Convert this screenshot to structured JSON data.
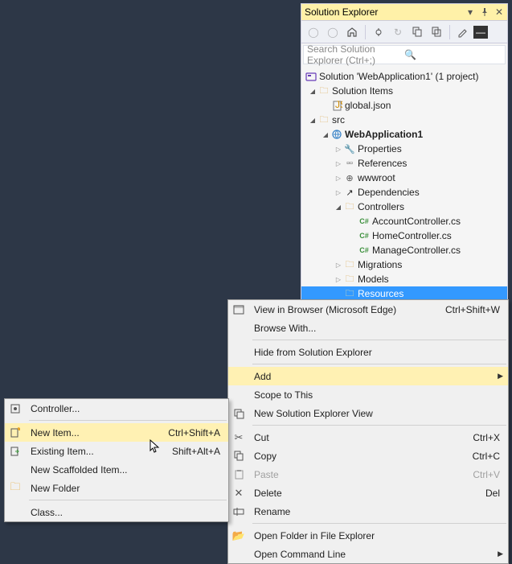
{
  "panel": {
    "title": "Solution Explorer",
    "search_placeholder": "Search Solution Explorer (Ctrl+;)",
    "solution_line": "Solution 'WebApplication1' (1 project)"
  },
  "tree": {
    "solutionItems": "Solution Items",
    "globalJson": "global.json",
    "src": "src",
    "project": "WebApplication1",
    "properties": "Properties",
    "references": "References",
    "wwwroot": "wwwroot",
    "dependencies": "Dependencies",
    "controllers": "Controllers",
    "ctrl1": "AccountController.cs",
    "ctrl2": "HomeController.cs",
    "ctrl3": "ManageController.cs",
    "migrations": "Migrations",
    "models": "Models",
    "resources": "Resources"
  },
  "menu1": [
    {
      "icon": "browser",
      "label": "View in Browser (Microsoft Edge)",
      "shortcut": "Ctrl+Shift+W"
    },
    {
      "icon": "",
      "label": "Browse With..."
    },
    {
      "sep": true
    },
    {
      "icon": "",
      "label": "Hide from Solution Explorer"
    },
    {
      "sep": true
    },
    {
      "icon": "",
      "label": "Add",
      "sub": true,
      "hl": true
    },
    {
      "icon": "",
      "label": "Scope to This"
    },
    {
      "icon": "newview",
      "label": "New Solution Explorer View"
    },
    {
      "sep": true
    },
    {
      "icon": "cut",
      "label": "Cut",
      "shortcut": "Ctrl+X"
    },
    {
      "icon": "copy",
      "label": "Copy",
      "shortcut": "Ctrl+C"
    },
    {
      "icon": "paste",
      "label": "Paste",
      "shortcut": "Ctrl+V",
      "dis": true
    },
    {
      "icon": "del",
      "label": "Delete",
      "shortcut": "Del"
    },
    {
      "icon": "rename",
      "label": "Rename"
    },
    {
      "sep": true
    },
    {
      "icon": "openf",
      "label": "Open Folder in File Explorer"
    },
    {
      "icon": "",
      "label": "Open Command Line",
      "sub": true
    }
  ],
  "menu2": [
    {
      "icon": "ctrl",
      "label": "Controller..."
    },
    {
      "sep": true
    },
    {
      "icon": "newitem",
      "label": "New Item...",
      "shortcut": "Ctrl+Shift+A",
      "hl": true
    },
    {
      "icon": "exitem",
      "label": "Existing Item...",
      "shortcut": "Shift+Alt+A"
    },
    {
      "icon": "",
      "label": "New Scaffolded Item..."
    },
    {
      "icon": "newfolder",
      "label": "New Folder"
    },
    {
      "sep": true
    },
    {
      "icon": "",
      "label": "Class..."
    }
  ]
}
